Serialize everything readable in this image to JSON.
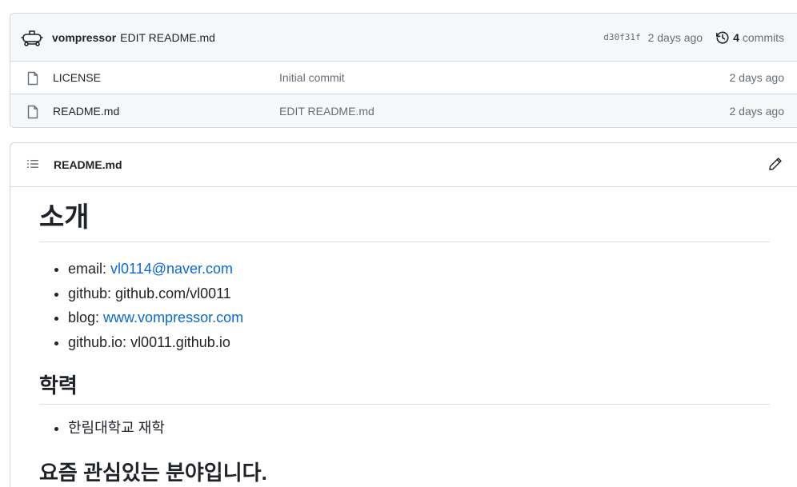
{
  "latest_commit": {
    "author": "vompressor",
    "message": "EDIT README.md",
    "sha": "d30f31f",
    "date": "2 days ago",
    "commits_count": "4",
    "commits_label": "commits"
  },
  "files": [
    {
      "name": "LICENSE",
      "message": "Initial commit",
      "date": "2 days ago",
      "icon": "file-icon"
    },
    {
      "name": "README.md",
      "message": "EDIT README.md",
      "date": "2 days ago",
      "icon": "file-icon"
    }
  ],
  "readme": {
    "filename": "README.md",
    "h1": "소개",
    "contact": [
      {
        "label": "email: ",
        "value": "vl0114@naver.com",
        "is_link": true
      },
      {
        "label": "github: ",
        "value": "github.com/vl0011",
        "is_link": false
      },
      {
        "label": "blog: ",
        "value": "www.vompressor.com",
        "is_link": true
      },
      {
        "label": "github.io: ",
        "value": "vl0011.github.io",
        "is_link": false
      }
    ],
    "education_heading": "학력",
    "education": [
      "한림대학교 재학"
    ],
    "interests_heading": "요즘 관심있는 분야입니다."
  },
  "colors": {
    "link": "#0969da",
    "muted": "#656d76",
    "border": "#d0d7de"
  }
}
